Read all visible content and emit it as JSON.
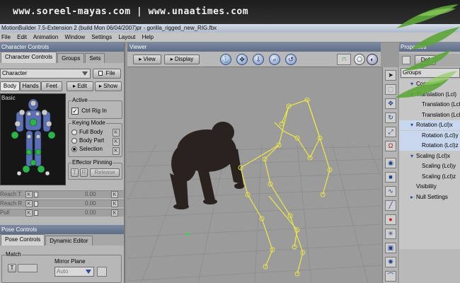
{
  "banner": {
    "text": "www.soreel-mayas.com | www.unaatimes.com"
  },
  "window": {
    "title": "MotionBuilder 7.5-Extension 2 (build Mon 06/04/2007)pr - gorilla_rigged_new_RIG.fbx"
  },
  "menu": [
    "File",
    "Edit",
    "Animation",
    "Window",
    "Settings",
    "Layout",
    "Help"
  ],
  "character_controls": {
    "title": "Character Controls",
    "tabs": [
      "Character Controls",
      "Groups",
      "Sets"
    ],
    "character_dropdown": "Character",
    "file_button": "File",
    "view_tabs": [
      "Body",
      "Hands",
      "Feet"
    ],
    "edit_button": "Edit",
    "show_button": "Show",
    "basic_label": "Basic",
    "active_group": {
      "title": "Active",
      "checkbox_label": "Ctrl Rig In",
      "checked": true
    },
    "keying_mode": {
      "title": "Keying Mode",
      "options": [
        "Full Body",
        "Body Part",
        "Selection"
      ],
      "selected": "Selection",
      "key_label": "K"
    },
    "effector_pinning": {
      "title": "Effector Pinning",
      "t_label": "T",
      "r_label": "R",
      "release_label": "Release"
    },
    "sliders": [
      {
        "label": "Reach T",
        "key_label": "K",
        "value": "0.00"
      },
      {
        "label": "Reach R",
        "key_label": "K",
        "value": "0.00"
      },
      {
        "label": "Pull",
        "key_label": "K",
        "value": "0.00"
      }
    ]
  },
  "pose_controls": {
    "title": "Pose Controls",
    "tabs": [
      "Pose Controls",
      "Dynamic Editor"
    ],
    "match_label": "Match",
    "t_label": "T",
    "mirror_plane_label": "Mirror Plane",
    "mirror_dropdown": "Auto"
  },
  "viewer": {
    "title": "Viewer",
    "view_menu": "View",
    "display_menu": "Display",
    "nav_icons": [
      "anchor-icon",
      "move-icon",
      "down-arrow-icon",
      "zoom-icon",
      "undo-icon"
    ]
  },
  "tools": [
    "select-icon",
    "lock-icon",
    "translate-icon",
    "rotate-icon",
    "scale-icon",
    "magnet-icon",
    "paint-icon",
    "cube-icon",
    "curve-icon",
    "bone-icon",
    "record-icon",
    "star-icon",
    "pin-icon",
    "sun-icon",
    "hook-icon"
  ],
  "properties": {
    "title": "Properties",
    "tab": "Def",
    "category": "Groups",
    "rows": [
      {
        "label": "Common",
        "indent": 0,
        "expand": "minus",
        "highlight": false
      },
      {
        "label": "Translation (Lcl)",
        "indent": 1,
        "expand": "minus",
        "highlight": false
      },
      {
        "label": "Translation (Lcl)",
        "indent": 2,
        "expand": "",
        "highlight": false
      },
      {
        "label": "Translation (Lcl)",
        "indent": 2,
        "expand": "",
        "highlight": false
      },
      {
        "label": "Rotation (Lcl)x",
        "indent": 1,
        "expand": "minus",
        "highlight": true
      },
      {
        "label": "Rotation (Lcl)y",
        "indent": 2,
        "expand": "",
        "highlight": true
      },
      {
        "label": "Rotation (Lcl)z",
        "indent": 2,
        "expand": "",
        "highlight": true
      },
      {
        "label": "Scaling (Lcl)x",
        "indent": 1,
        "expand": "minus",
        "highlight": false
      },
      {
        "label": "Scaling (Lcl)y",
        "indent": 2,
        "expand": "",
        "highlight": false
      },
      {
        "label": "Scaling (Lcl)z",
        "indent": 2,
        "expand": "",
        "highlight": false
      },
      {
        "label": "Visibility",
        "indent": 1,
        "expand": "",
        "highlight": false
      },
      {
        "label": "Null Settings",
        "indent": 1,
        "expand": "plus",
        "highlight": false
      }
    ]
  },
  "colors": {
    "panel_header": "#6b7a93",
    "skeleton": "#e7e34a",
    "selected_row": "#c8d6ee",
    "avatar_bg": "#161616"
  }
}
